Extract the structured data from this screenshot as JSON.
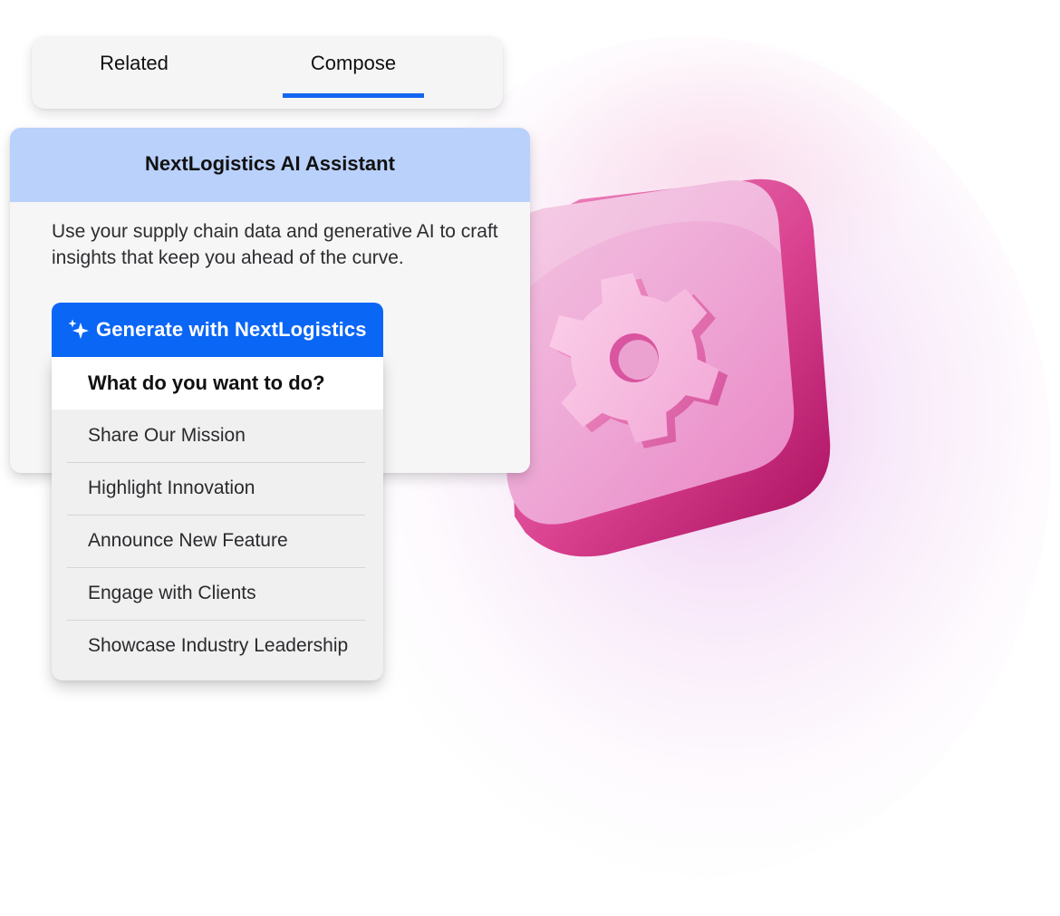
{
  "tabs": {
    "items": [
      {
        "label": "Related",
        "selected": false
      },
      {
        "label": "Compose",
        "selected": true
      }
    ],
    "accent_color": "#1466ef"
  },
  "assistant": {
    "title": "NextLogistics AI Assistant",
    "description": "Use your supply chain data and generative AI to craft insights that keep you ahead of the curve.",
    "header_color": "#b9d1fb"
  },
  "generate_button": {
    "label": "Generate with NextLogistics",
    "icon": "sparkle-icon",
    "color": "#0a66f5"
  },
  "dropdown": {
    "heading": "What do you want to do?",
    "options": [
      "Share Our Mission",
      "Highlight Innovation",
      "Announce New Feature",
      "Engage with Clients",
      "Showcase Industry Leadership"
    ]
  },
  "illustration": {
    "icon": "gear-icon",
    "color": "#e879c0"
  }
}
